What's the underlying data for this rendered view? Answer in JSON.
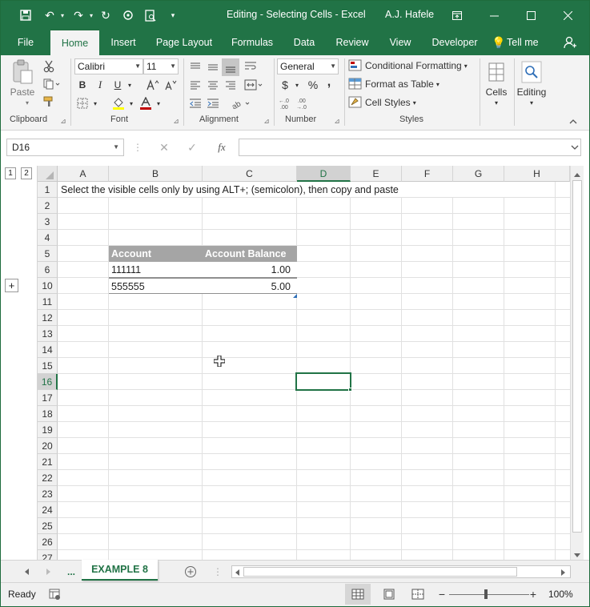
{
  "titlebar": {
    "title": "Editing - Selecting Cells  -  Excel",
    "user": "A.J. Hafele"
  },
  "tabs": [
    "File",
    "Home",
    "Insert",
    "Page Layout",
    "Formulas",
    "Data",
    "Review",
    "View",
    "Developer",
    "Tell me"
  ],
  "ribbon": {
    "clipboard": {
      "paste_label": "Paste",
      "group_label": "Clipboard"
    },
    "font": {
      "font_name": "Calibri",
      "font_size": "11",
      "bold": "B",
      "italic": "I",
      "underline": "U",
      "group_label": "Font"
    },
    "alignment": {
      "group_label": "Alignment"
    },
    "number": {
      "format": "General",
      "currency": "$",
      "percent": "%",
      "comma": ",",
      "group_label": "Number"
    },
    "styles": {
      "conditional": "Conditional Formatting",
      "format_table": "Format as Table",
      "cell_styles": "Cell Styles",
      "group_label": "Styles"
    },
    "cells": {
      "label": "Cells"
    },
    "editing": {
      "label": "Editing"
    }
  },
  "formula_bar": {
    "name_box": "D16",
    "fx": "fx",
    "value": ""
  },
  "outline": {
    "levels": [
      "1",
      "2"
    ],
    "expand": "+"
  },
  "columns": [
    "A",
    "B",
    "C",
    "D",
    "E",
    "F",
    "G",
    "H"
  ],
  "rows": [
    "1",
    "2",
    "3",
    "4",
    "5",
    "6",
    "10",
    "11",
    "12",
    "13",
    "14",
    "15",
    "16",
    "17",
    "18",
    "19",
    "20",
    "21",
    "22",
    "23",
    "24",
    "25",
    "26",
    "27"
  ],
  "cells": {
    "a1": "Select the visible cells only by using ALT+; (semicolon), then copy and paste",
    "b5": "Account",
    "c5": "Account Balance",
    "b6": "111111",
    "c6": "1.00",
    "b10": "555555",
    "c10": "5.00"
  },
  "sheetbar": {
    "ellipsis": "...",
    "active_sheet": "EXAMPLE 8"
  },
  "status": {
    "ready": "Ready",
    "zoom": "100%"
  },
  "colors": {
    "excel_green": "#217346",
    "table_header": "#a5a5a5"
  }
}
